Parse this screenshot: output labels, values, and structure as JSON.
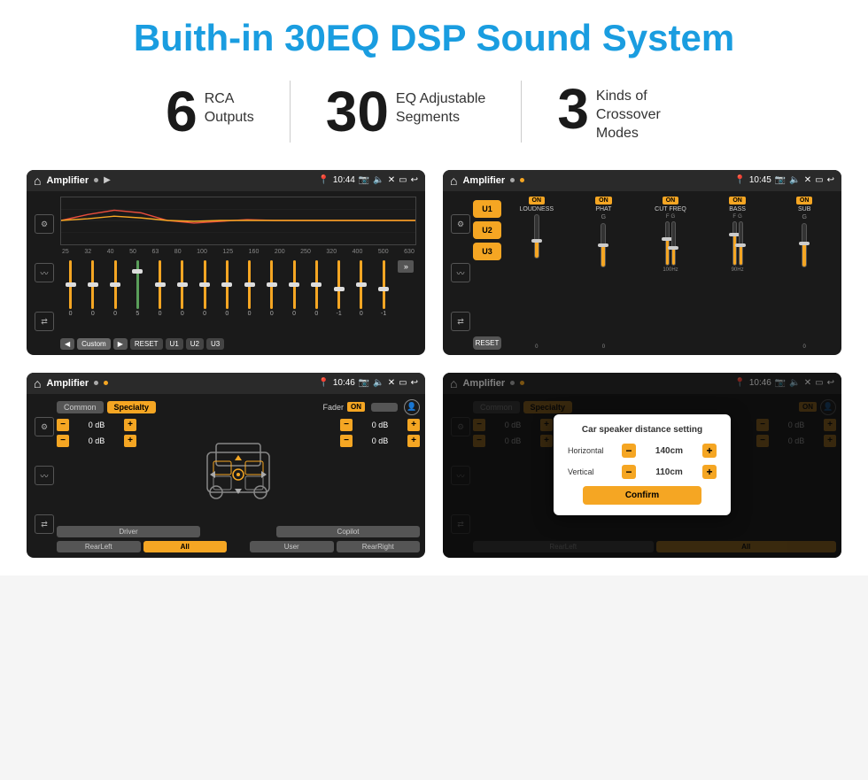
{
  "header": {
    "title": "Buith-in 30EQ DSP Sound System"
  },
  "stats": [
    {
      "number": "6",
      "label": "RCA\nOutputs"
    },
    {
      "number": "30",
      "label": "EQ Adjustable\nSegments"
    },
    {
      "number": "3",
      "label": "Kinds of\nCrossover Modes"
    }
  ],
  "screens": [
    {
      "id": "eq-screen",
      "time": "10:44",
      "title": "Amplifier",
      "type": "eq",
      "freqs": [
        "25",
        "32",
        "40",
        "50",
        "63",
        "80",
        "100",
        "125",
        "160",
        "200",
        "250",
        "320",
        "400",
        "500",
        "630"
      ],
      "sliders": [
        "0",
        "0",
        "0",
        "5",
        "0",
        "0",
        "0",
        "0",
        "0",
        "0",
        "0",
        "0",
        "-1",
        "0",
        "-1"
      ],
      "mode": "Custom",
      "presets": [
        "U1",
        "U2",
        "U3"
      ]
    },
    {
      "id": "crossover-screen",
      "time": "10:45",
      "title": "Amplifier",
      "type": "crossover",
      "units": [
        "U1",
        "U2",
        "U3"
      ],
      "channels": [
        {
          "label": "LOUDNESS",
          "on": true
        },
        {
          "label": "PHAT",
          "on": true
        },
        {
          "label": "CUT FREQ",
          "on": true
        },
        {
          "label": "BASS",
          "on": true
        },
        {
          "label": "SUB",
          "on": true
        }
      ]
    },
    {
      "id": "fader-screen",
      "time": "10:46",
      "title": "Amplifier",
      "type": "fader",
      "tabs": [
        "Common",
        "Specialty"
      ],
      "faderLabel": "Fader",
      "dbValues": [
        "0 dB",
        "0 dB",
        "0 dB",
        "0 dB"
      ],
      "bottomBtns": [
        "Driver",
        "All",
        "RearLeft",
        "User",
        "RearRight",
        "Copilot"
      ]
    },
    {
      "id": "dialog-screen",
      "time": "10:46",
      "title": "Amplifier",
      "type": "dialog",
      "dialog": {
        "title": "Car speaker distance setting",
        "horizontal": {
          "label": "Horizontal",
          "value": "140cm"
        },
        "vertical": {
          "label": "Vertical",
          "value": "110cm"
        },
        "confirm": "Confirm"
      }
    }
  ]
}
